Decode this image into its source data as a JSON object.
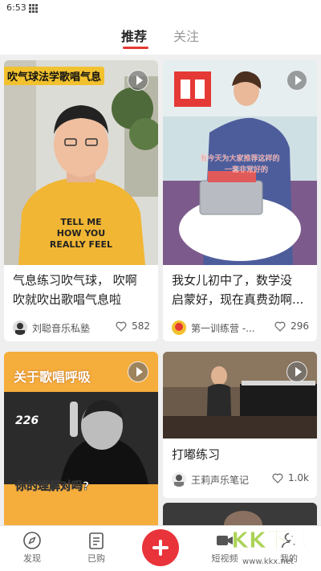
{
  "status": {
    "time": "6:53"
  },
  "tabs": [
    {
      "label": "推荐"
    },
    {
      "label": "关注"
    }
  ],
  "cards": [
    {
      "overlay": "吹气球法学歌唱气息",
      "shirt_text": [
        "TELL ME",
        "HOW YOU",
        "REALLY FEEL"
      ],
      "title": [
        "气息练习吹气球， 吹啊",
        "吹就吹出歌唱气息啦"
      ],
      "author": "刘聪音乐私塾",
      "likes": "582"
    },
    {
      "caption": [
        "我今天为大家推荐这样的",
        "一套非常好的"
      ],
      "title": [
        "我女儿初中了，数学没",
        "启蒙好，现在真费劲啊..."
      ],
      "author": "第一训练营 -...",
      "likes": "296"
    },
    {
      "overlay": "关于歌唱呼吸",
      "poster_text": "226",
      "bottom_text": "你的理解对吗?",
      "title": [],
      "author": "",
      "likes": ""
    },
    {
      "title": [
        "打嘟练习"
      ],
      "author": "王莉声乐笔记",
      "likes": "1.0k"
    }
  ],
  "nav": {
    "discover": "发现",
    "purchased": "已购",
    "shorts": "短视频",
    "mine": "我的"
  },
  "watermark": "KK下载",
  "watermark_url": "www.kkx.net",
  "colors": {
    "accent": "#e53935",
    "card_bg": "#ffffff",
    "page_bg": "#efefef"
  }
}
